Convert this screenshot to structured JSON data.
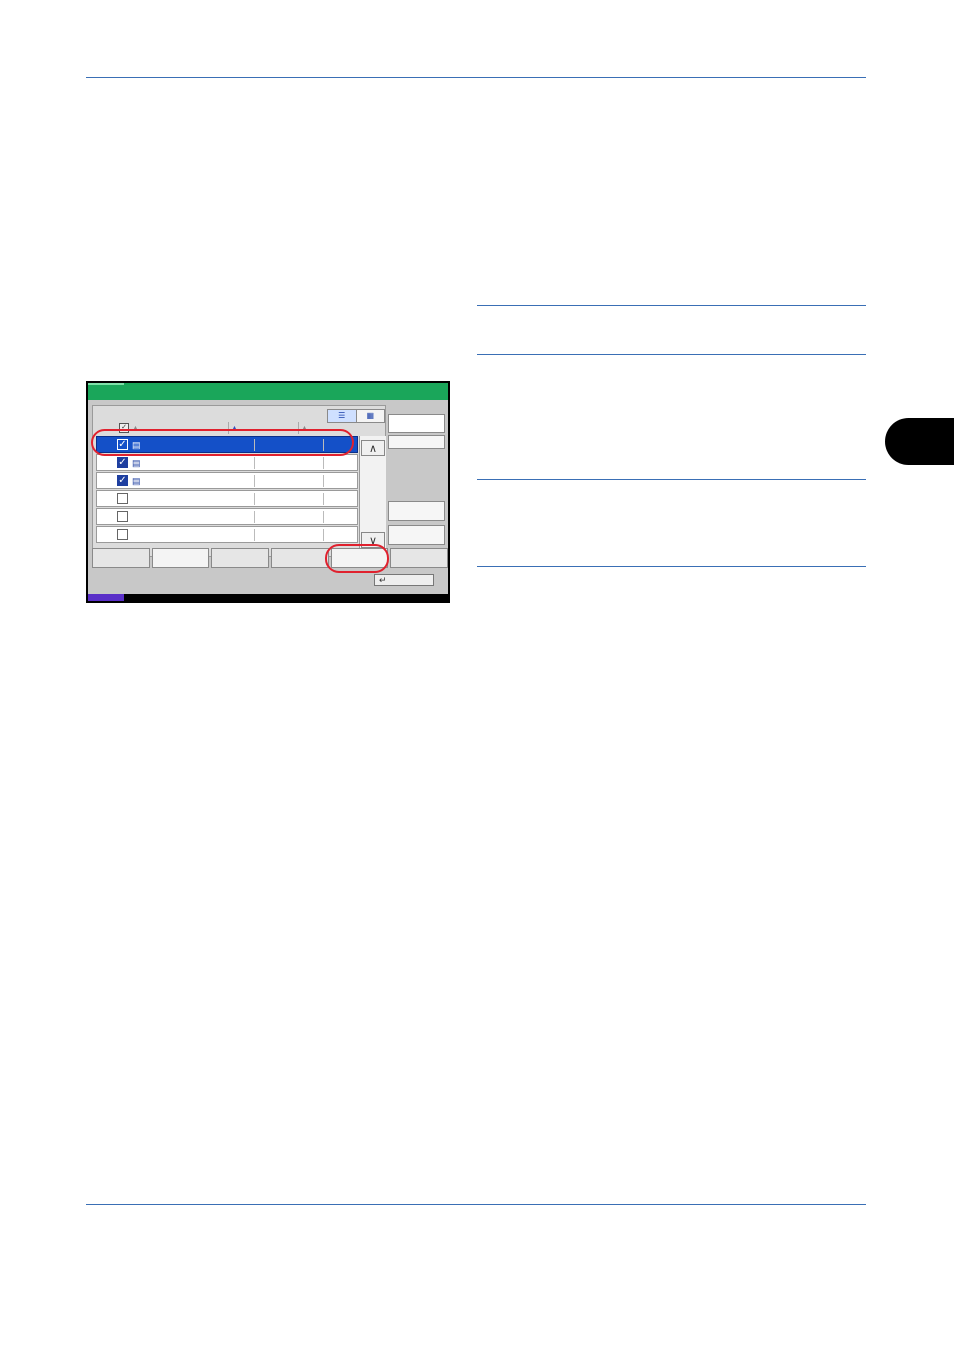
{
  "colors": {
    "rule": "#3a6fb5",
    "panel_header": "#1aa65a",
    "selection": "#1450c8",
    "highlight": "#e0212e",
    "status_indicator": "#5a2fc8"
  },
  "panel": {
    "view_toggle": {
      "list_icon": "list-view-icon",
      "thumb_icon": "thumbnail-view-icon",
      "active": "list"
    },
    "sort_arrows": [
      "▲",
      "▲",
      "▲"
    ],
    "rows": [
      {
        "checked": true,
        "selected": true,
        "icon": "document-icon"
      },
      {
        "checked": true,
        "selected": false,
        "icon": "document-icon"
      },
      {
        "checked": true,
        "selected": false,
        "icon": "document-icon"
      },
      {
        "checked": false,
        "selected": false,
        "icon": ""
      },
      {
        "checked": false,
        "selected": false,
        "icon": ""
      },
      {
        "checked": false,
        "selected": false,
        "icon": ""
      }
    ],
    "scroll_up": "∧",
    "scroll_down": "∨",
    "ok_glyph": "↵"
  }
}
